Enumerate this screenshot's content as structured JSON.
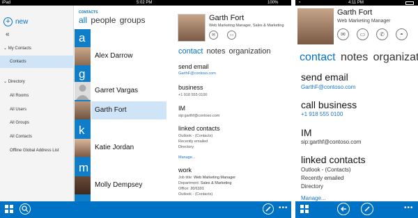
{
  "left_panel": {
    "status": {
      "device": "iPad",
      "time": "5:02 PM",
      "battery": "100%"
    },
    "new_label": "new",
    "collapse_glyph": "«",
    "nav": {
      "my_contacts": "My Contacts",
      "contacts": "Contacts",
      "directory": "Directory",
      "all_rooms": "All Rooms",
      "all_users": "All Users",
      "all_groups": "All Groups",
      "all_contacts": "All Contacts",
      "offline_gal": "Offline Global Address List"
    },
    "list": {
      "header": "CONTACTS",
      "tabs": [
        "all",
        "people",
        "groups"
      ],
      "letters": [
        "a",
        "g",
        "k",
        "m"
      ],
      "people": [
        "Alex Darrow",
        "Garret Vargas",
        "Garth Fort",
        "Katie Jordan",
        "Molly Dempsey"
      ]
    },
    "detail": {
      "name": "Garth Fort",
      "title": "Web Marketing Manager, Sales & Marketing",
      "tabs": [
        "contact",
        "notes",
        "organization"
      ],
      "send_email_label": "send email",
      "email": "GarthF@contoso.com",
      "business_label": "business",
      "phone": "+1 918 555 0100",
      "im_label": "IM",
      "im": "sip:garthf@contoso.com",
      "linked_label": "linked contacts",
      "linked": [
        "Outlook - (Contacts)",
        "Recently emailed",
        "Directory"
      ],
      "manage": "Manage...",
      "work_label": "work",
      "job_title_key": "Job title:",
      "job_title_val": "Web Marketing Manager",
      "department_key": "Department:",
      "department_val": "Sales & Marketing",
      "office_key": "Office:",
      "office_val": "20/1101",
      "work_source": "Outlook - (Contacts)"
    }
  },
  "right_panel": {
    "status": {
      "time": "4:11 PM"
    },
    "name": "Garth Fort",
    "title": "Web Marketing Manager",
    "tabs": [
      "contact",
      "notes",
      "organizatio"
    ],
    "send_email_label": "send email",
    "email": "GarthF@contoso.com",
    "call_label": "call business",
    "phone": "+1 918 555 0100",
    "im_label": "IM",
    "im": "sip:garthf@contoso.com",
    "linked_label": "linked contacts",
    "linked": [
      "Outlook - (Contacts)",
      "Recently emailed",
      "Directory"
    ],
    "manage": "Manage..."
  },
  "colors": {
    "accent": "#0072c6",
    "selected": "#cfe4f7",
    "letter_tile": "#0f7dc8"
  }
}
